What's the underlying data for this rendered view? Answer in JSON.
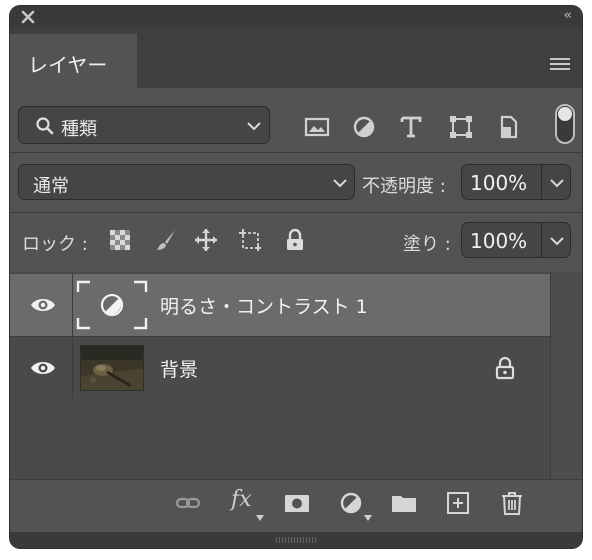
{
  "panel": {
    "tab_label": "レイヤー",
    "collapse_glyph": "‹‹"
  },
  "filter": {
    "kind_label": "種類"
  },
  "blend": {
    "mode_label": "通常",
    "opacity_label": "不透明度 :",
    "opacity_value": "100%",
    "fill_label": "塗り :",
    "fill_value": "100%"
  },
  "lock": {
    "label": "ロック :"
  },
  "layers": [
    {
      "name": "明るさ・コントラスト 1",
      "visible": true,
      "selected": true,
      "type": "adjustment"
    },
    {
      "name": "背景",
      "visible": true,
      "selected": false,
      "type": "image",
      "locked": true
    }
  ],
  "colors": {
    "panel_bg": "#535353",
    "selected_row": "#6b6b6b",
    "field_bg": "#454545"
  }
}
